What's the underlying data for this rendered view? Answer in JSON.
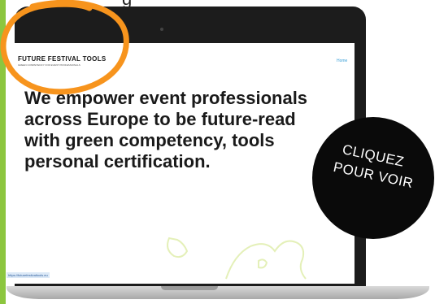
{
  "top_caption": "g",
  "site": {
    "logo_title": "FUTURE FESTIVAL TOOLS",
    "logo_subtitle": "GREEN COMPETENCY FOR EVENT PROFESSIONALS",
    "nav_home": "Home",
    "hero_lines": [
      "We empower event professionals",
      "across Europe to be future-read",
      "with green competency, tools",
      "personal certification."
    ],
    "status_url": "https://futurefestivaltools.eu"
  },
  "badge": {
    "line1": "CLIQUEZ",
    "line2": "POUR VOIR"
  },
  "colors": {
    "accent_bar": "#8cc63f",
    "annotation_circle": "#f7941d",
    "badge_bg": "#0a0a0a",
    "map_outline": "#e4f0b8"
  }
}
